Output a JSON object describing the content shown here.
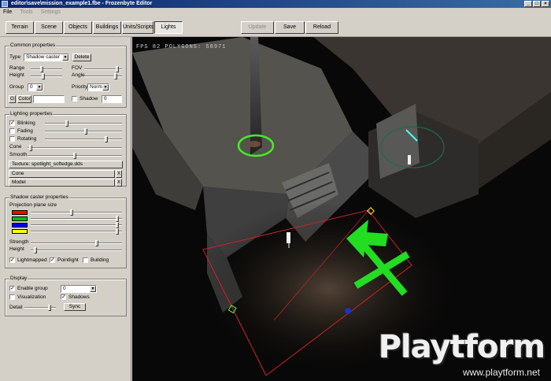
{
  "window": {
    "title": "editor\\save\\mission_example1.fbe - Frozenbyte Editor"
  },
  "menu": [
    {
      "label": "File",
      "enabled": true
    },
    {
      "label": "Tools",
      "enabled": false
    },
    {
      "label": "Settings",
      "enabled": false
    }
  ],
  "toolbar": {
    "tabs": [
      "Terrain",
      "Scene",
      "Objects",
      "Buildings",
      "Units/Scripts",
      "Lights"
    ],
    "active_tab": "Lights",
    "update_label": "Update",
    "save_label": "Save",
    "reload_label": "Reload"
  },
  "common": {
    "title": "Common properties",
    "type_label": "Type",
    "type_value": "Shadow caster",
    "delete_label": "Delete",
    "range_label": "Range",
    "fov_label": "FOV",
    "height_label": "Height",
    "angle_label": "Angle",
    "group_label": "Group",
    "group_value": "0",
    "priority_label": "Priority",
    "priority_value": "Normal",
    "g_label": "G",
    "color_label": "Color",
    "shadow_label": "Shadow",
    "shadow_value": "0"
  },
  "lighting": {
    "title": "Lighting properties",
    "blinking_label": "Blinking",
    "blinking_checked": true,
    "fading_label": "Fading",
    "fading_checked": false,
    "rotating_label": "Rotating",
    "rotating_checked": false,
    "cone_label": "Cone",
    "smooth_label": "Smooth",
    "texture_label": "Texture: spotlight_softedge.dds",
    "cone_button": "Cone",
    "model_button": "Model",
    "clear_symbol": "X"
  },
  "shadow": {
    "title": "Shadow caster properties",
    "plane_label": "Projection plane size",
    "swatches": [
      "#ff0000",
      "#00c000",
      "#0000ff",
      "#ffff00"
    ],
    "strength_label": "Strength",
    "height_label": "Height",
    "lightmapped_label": "Lightmapped",
    "lightmapped_checked": true,
    "pointlight_label": "Pointlight",
    "pointlight_checked": true,
    "building_label": "Building",
    "building_checked": false
  },
  "display": {
    "title": "Display",
    "enable_group_label": "Enable group",
    "enable_group_checked": true,
    "enable_group_value": "0",
    "visualization_label": "Visualization",
    "visualization_checked": false,
    "shadows_label": "Shadows",
    "shadows_checked": true,
    "detail_label": "Detail",
    "sync_label": "Sync"
  },
  "viewport": {
    "hud_text": "FPS 82  POLYGONS: 58971",
    "watermark": "Playtform",
    "watermark_url": "www.playtform.net"
  },
  "colors": {
    "titlebar": "#0a246a",
    "arrow": "#22dd22",
    "shadow_area": "#cc2222"
  }
}
